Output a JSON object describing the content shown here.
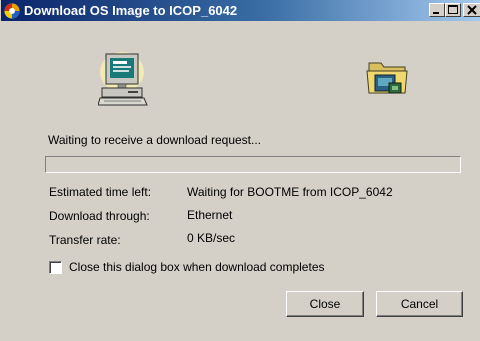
{
  "window": {
    "title": "Download OS Image to ICOP_6042",
    "controls": {
      "minimize_icon": "minimize-icon",
      "maximize_icon": "maximize-icon",
      "close_icon": "close-icon"
    }
  },
  "icons": {
    "app": "app-logo-icon",
    "source": "computer-icon",
    "target": "device-folder-icon"
  },
  "status": {
    "message": "Waiting to receive a download request...",
    "progress": 0
  },
  "details": [
    {
      "label": "Estimated time left:",
      "value": "Waiting for BOOTME from ICOP_6042"
    },
    {
      "label": "Download through:",
      "value": "Ethernet"
    },
    {
      "label": "Transfer rate:",
      "value": "0 KB/sec"
    }
  ],
  "options": {
    "close_on_complete_label": "Close this dialog box when download completes",
    "close_on_complete_checked": false
  },
  "buttons": {
    "close_label": "Close",
    "cancel_label": "Cancel"
  },
  "colors": {
    "title_gradient_start": "#0a246a",
    "title_gradient_end": "#a6caf0",
    "dialog_face": "#d4d0c8"
  }
}
